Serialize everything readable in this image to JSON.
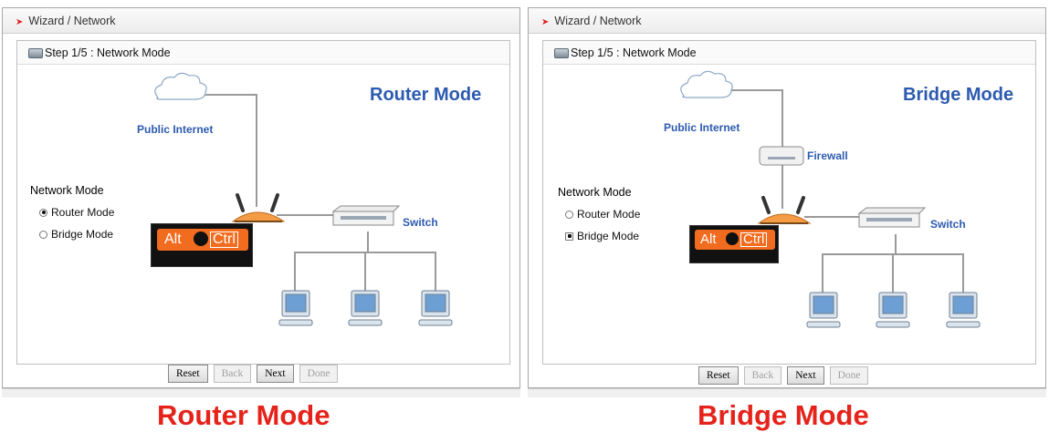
{
  "panels": [
    {
      "breadcrumb": "Wizard / Network",
      "step": "Step 1/5 : Network Mode",
      "mode_title": "Router Mode",
      "labels": {
        "internet": "Public Internet",
        "switch": "Switch",
        "firewall": ""
      },
      "network_mode": {
        "heading": "Network Mode",
        "options": [
          "Router Mode",
          "Bridge Mode"
        ],
        "selected": "Router Mode"
      },
      "device_logo": {
        "left": "Alt",
        "right": "Ctrl"
      },
      "buttons": [
        {
          "label": "Reset",
          "enabled": true
        },
        {
          "label": "Back",
          "enabled": false
        },
        {
          "label": "Next",
          "enabled": true
        },
        {
          "label": "Done",
          "enabled": false
        }
      ],
      "caption": "Router Mode"
    },
    {
      "breadcrumb": "Wizard / Network",
      "step": "Step 1/5 : Network Mode",
      "mode_title": "Bridge Mode",
      "labels": {
        "internet": "Public Internet",
        "switch": "Switch",
        "firewall": "Firewall"
      },
      "network_mode": {
        "heading": "Network Mode",
        "options": [
          "Router Mode",
          "Bridge Mode"
        ],
        "selected": "Bridge Mode"
      },
      "device_logo": {
        "left": "Alt",
        "right": "Ctrl"
      },
      "buttons": [
        {
          "label": "Reset",
          "enabled": true
        },
        {
          "label": "Back",
          "enabled": false
        },
        {
          "label": "Next",
          "enabled": true
        },
        {
          "label": "Done",
          "enabled": false
        }
      ],
      "caption": "Bridge Mode"
    }
  ],
  "colors": {
    "accent": "#2c5ab0",
    "caption": "#e5231b",
    "logo_bg": "#f26c1f"
  }
}
